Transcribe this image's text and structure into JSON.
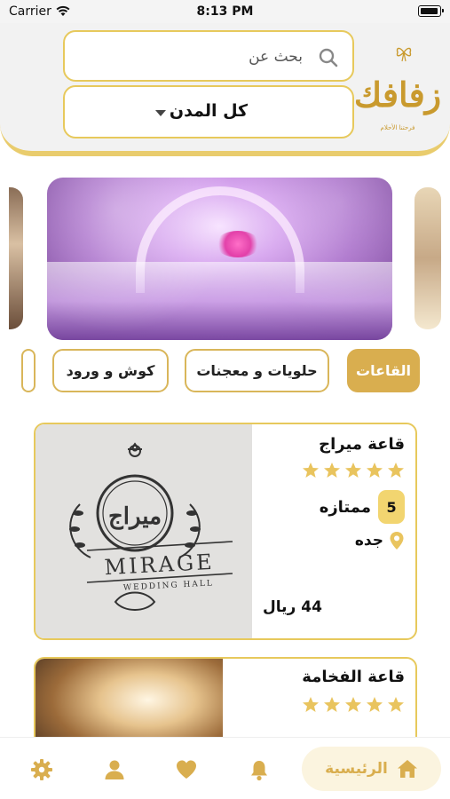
{
  "status_bar": {
    "carrier": "Carrier",
    "time": "8:13 PM"
  },
  "header": {
    "search_placeholder": "بحث عن",
    "city_select_value": "كل المدن",
    "logo_text": "زفافك",
    "logo_tagline": "فرحتنا الأحلام"
  },
  "categories": [
    {
      "label": "القاعات",
      "active": true
    },
    {
      "label": "حلويات و معجنات",
      "active": false
    },
    {
      "label": "كوش و ورود",
      "active": false
    }
  ],
  "halls": [
    {
      "name": "قاعة ميراج",
      "stars": 5,
      "rating": "5",
      "rating_label": "ممتازه",
      "city": "جده",
      "price": "44 ريال",
      "logo_text": "ميراج",
      "logo_latin": "MIRAGE",
      "logo_sub": "WEDDING HALL"
    },
    {
      "name": "قاعة الفخامة",
      "stars": 5
    }
  ],
  "bottom_nav": {
    "home_label": "الرئيسية"
  },
  "colors": {
    "gold": "#d9ae4f",
    "gold_border": "#e7c95c",
    "star": "#e9c45e",
    "badge": "#f2d570"
  }
}
